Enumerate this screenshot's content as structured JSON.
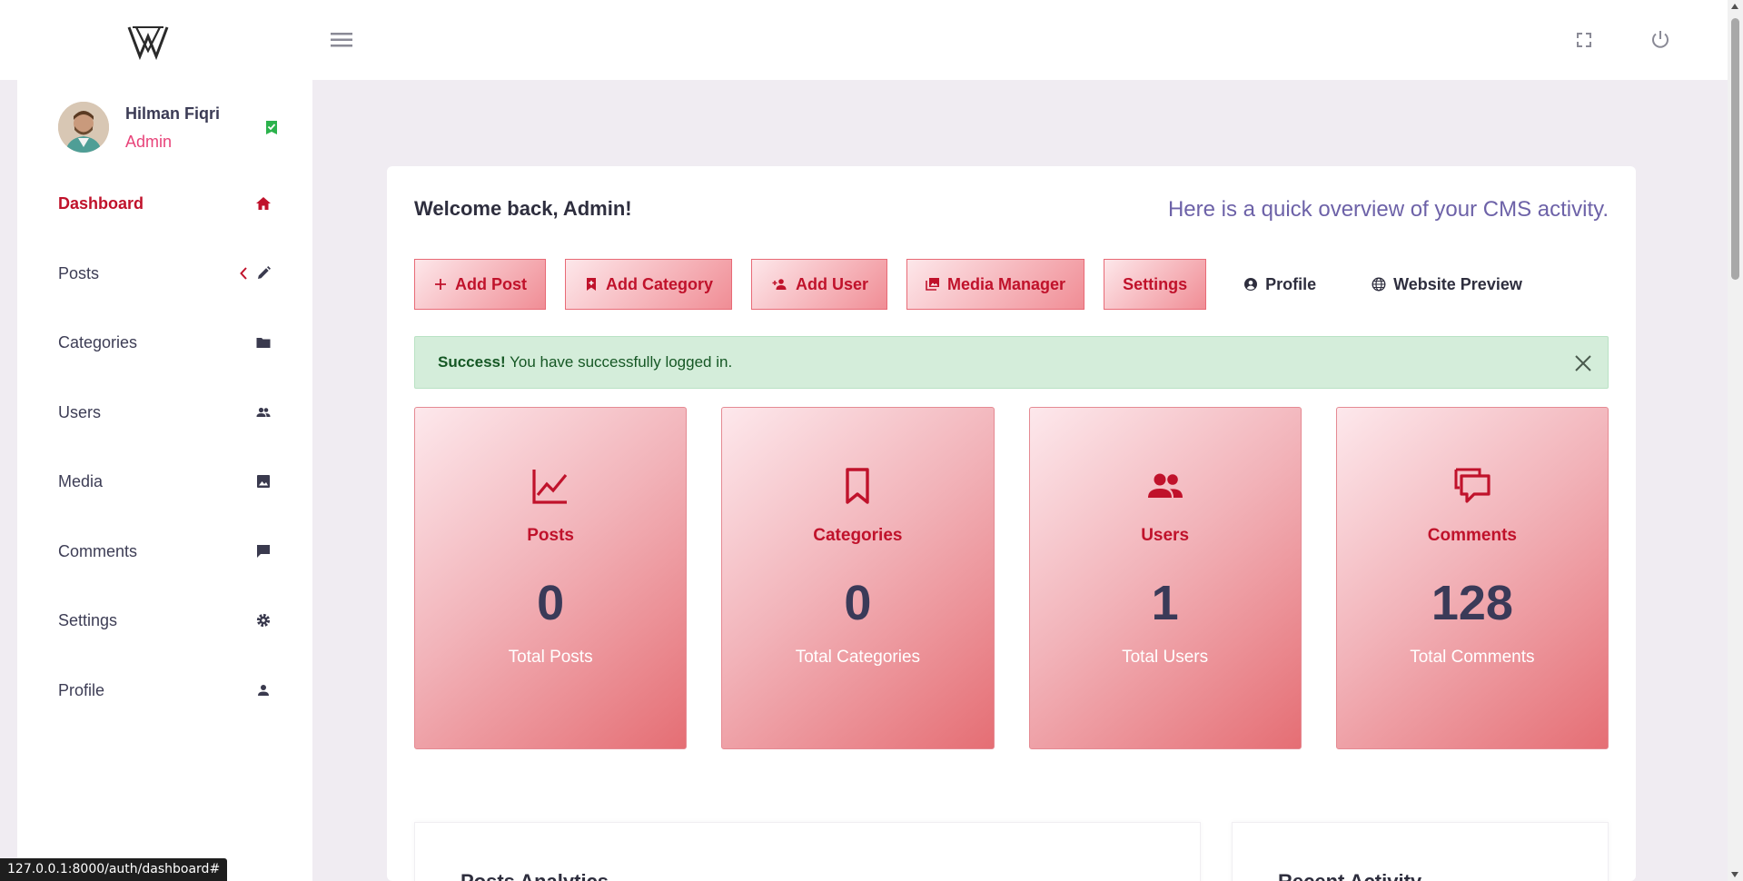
{
  "header": {
    "logo_icon": "w-logo",
    "menu_icon": "hamburger-icon",
    "fullscreen_icon": "fullscreen-icon",
    "power_icon": "power-icon"
  },
  "user": {
    "name": "Hilman Fiqri",
    "role": "Admin",
    "verified_icon": "check-badge-icon"
  },
  "sidebar": {
    "items": [
      {
        "label": "Dashboard",
        "icon": "home-icon",
        "active": true
      },
      {
        "label": "Posts",
        "icon": "pencil-icon",
        "expandable": true
      },
      {
        "label": "Categories",
        "icon": "folder-icon"
      },
      {
        "label": "Users",
        "icon": "users-icon"
      },
      {
        "label": "Media",
        "icon": "image-icon"
      },
      {
        "label": "Comments",
        "icon": "comment-icon"
      },
      {
        "label": "Settings",
        "icon": "gear-icon"
      },
      {
        "label": "Profile",
        "icon": "person-icon"
      }
    ]
  },
  "main": {
    "welcome": "Welcome back, Admin!",
    "overview": "Here is a quick overview of your CMS activity.",
    "actions": [
      {
        "label": "Add Post",
        "icon": "plus-icon"
      },
      {
        "label": "Add Category",
        "icon": "bookmark-plus-icon"
      },
      {
        "label": "Add User",
        "icon": "user-plus-icon"
      },
      {
        "label": "Media Manager",
        "icon": "images-icon"
      },
      {
        "label": "Settings",
        "icon": ""
      },
      {
        "label": "Profile",
        "icon": "user-circle-icon"
      },
      {
        "label": "Website Preview",
        "icon": "globe-icon"
      }
    ],
    "alert": {
      "strong": "Success!",
      "message": " You have successfully logged in."
    },
    "stats": [
      {
        "title": "Posts",
        "value": "0",
        "label": "Total Posts",
        "icon": "line-chart-icon"
      },
      {
        "title": "Categories",
        "value": "0",
        "label": "Total Categories",
        "icon": "bookmark-icon"
      },
      {
        "title": "Users",
        "value": "1",
        "label": "Total Users",
        "icon": "users-icon"
      },
      {
        "title": "Comments",
        "value": "128",
        "label": "Total Comments",
        "icon": "comments-icon"
      }
    ],
    "sections": {
      "posts_analytics": "Posts Analytics",
      "recent_activity": "Recent Activity"
    }
  },
  "status_bar": {
    "url": "127.0.0.1:8000/auth/dashboard#"
  },
  "colors": {
    "accent": "#c0122b",
    "role": "#e8447a",
    "overview": "#6d62a8",
    "success_bg": "#d4edda",
    "success_text": "#155724"
  }
}
